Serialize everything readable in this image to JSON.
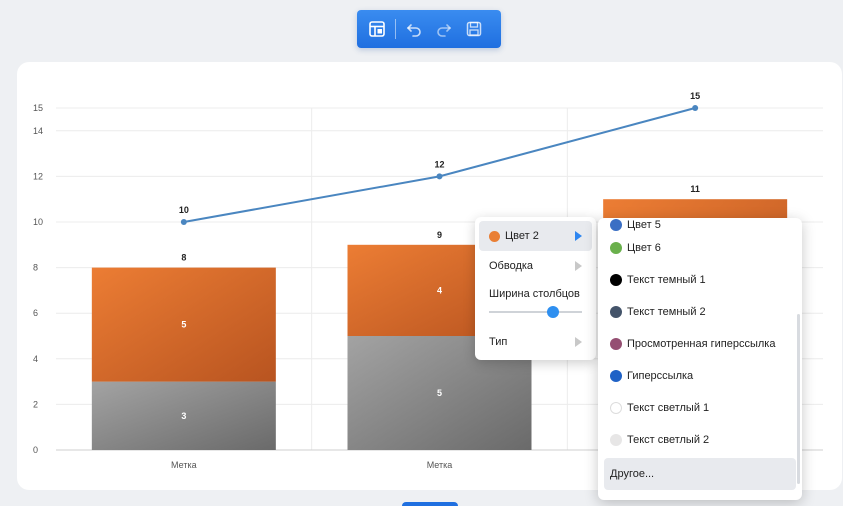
{
  "toolbar": {
    "buttons": [
      {
        "icon": "layout-icon",
        "name": "layout"
      },
      {
        "icon": "undo-icon",
        "name": "undo"
      },
      {
        "icon": "redo-icon",
        "name": "redo"
      },
      {
        "icon": "save-icon",
        "name": "save"
      }
    ],
    "accent": "#1f6fe0"
  },
  "chart_data": {
    "type": "bar",
    "stacked": true,
    "categories": [
      "Метка",
      "Метка",
      ""
    ],
    "series": [
      {
        "values": [
          3,
          5,
          null
        ],
        "color": "#7f7f7f",
        "kind": "bar"
      },
      {
        "values": [
          5,
          4,
          null
        ],
        "color": "#e07030",
        "kind": "bar"
      },
      {
        "values": [
          10,
          12,
          15
        ],
        "color": "#4a86c0",
        "kind": "line"
      }
    ],
    "totals": [
      8,
      9,
      11
    ],
    "ylim": [
      0,
      15
    ],
    "yticks": [
      0,
      2,
      4,
      6,
      8,
      10,
      12,
      14,
      15
    ],
    "grid": true
  },
  "context_menu": {
    "items": [
      {
        "label": "Цвет 2",
        "swatch": "#e97f35",
        "active": true
      },
      {
        "label": "Обводка"
      },
      {
        "label": "Ширина столбцов",
        "slider": 0.6
      },
      {
        "label": "Тип"
      }
    ]
  },
  "color_submenu": {
    "items": [
      {
        "label": "Цвет 5",
        "color": "#3a6fc4"
      },
      {
        "label": "Цвет 6",
        "color": "#6ab04c"
      },
      {
        "label": "Текст темный 1",
        "color": "#000000"
      },
      {
        "label": "Текст темный 2",
        "color": "#44546a"
      },
      {
        "label": "Просмотренная гиперссылка",
        "color": "#954f72"
      },
      {
        "label": "Гиперссылка",
        "color": "#1f62c6"
      },
      {
        "label": "Текст светлый 1",
        "color": "#ffffff"
      },
      {
        "label": "Текст светлый 2",
        "color": "#e7e6e6"
      }
    ],
    "other_label": "Другое..."
  }
}
